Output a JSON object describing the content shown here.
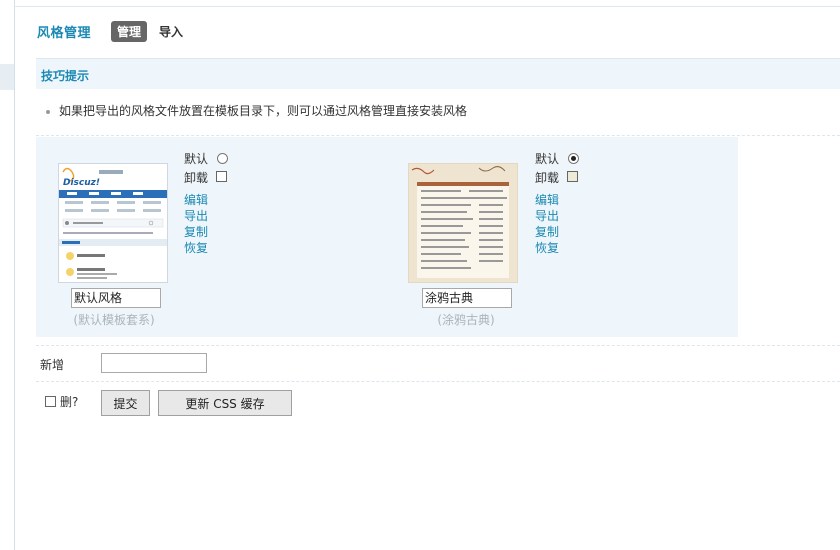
{
  "header": {
    "title": "风格管理",
    "tabs": [
      {
        "label": "管理",
        "active": true
      },
      {
        "label": "导入",
        "active": false
      }
    ]
  },
  "tips": {
    "title": "技巧提示",
    "items": [
      "如果把导出的风格文件放置在模板目录下，则可以通过风格管理直接安装风格"
    ]
  },
  "styles": [
    {
      "name": "默认风格",
      "subtitle": "(默认模板套系)",
      "default_label": "默认",
      "default_checked": false,
      "uninstall_label": "卸载",
      "uninstall_checked": false,
      "uninstall_disabled": false,
      "actions": [
        "编辑",
        "导出",
        "复制",
        "恢复"
      ],
      "thumbnail_logo": "Discuz!"
    },
    {
      "name": "涂鸦古典",
      "subtitle": "(涂鸦古典)",
      "default_label": "默认",
      "default_checked": true,
      "uninstall_label": "卸载",
      "uninstall_checked": false,
      "uninstall_disabled": true,
      "actions": [
        "编辑",
        "导出",
        "复制",
        "恢复"
      ]
    }
  ],
  "new_style": {
    "label": "新增",
    "value": ""
  },
  "footer": {
    "delete_label": "删?",
    "delete_checked": false,
    "submit_label": "提交",
    "update_css_label": "更新 CSS 缓存"
  },
  "colors": {
    "accent": "#1b89b3",
    "panel_bg": "#eef6fb",
    "tab_active_bg": "#666666"
  }
}
